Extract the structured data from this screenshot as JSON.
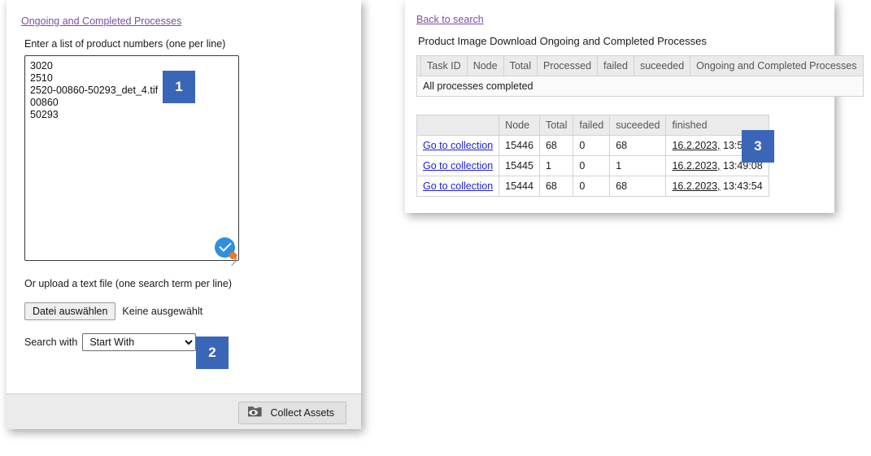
{
  "left_panel": {
    "top_link": "Ongoing and Completed Processes",
    "textarea_label": "Enter a list of product numbers (one per line)",
    "textarea_value": "3020\n2510\n2520-00860-50293_det_4.tif\n00860\n50293",
    "textarea_placeholder": "",
    "upload_label": "Or upload a text file (one search term per line)",
    "file_button_label": "Datei auswählen",
    "file_status_text": "Keine ausgewählt",
    "search_with_label": "Search with",
    "search_with_value": "Start With",
    "search_with_options": [
      "Start With"
    ],
    "footer": {
      "collect_button_label": "Collect Assets",
      "collect_button_icon": "folder-eye-icon"
    }
  },
  "right_panel": {
    "back_link": "Back to search",
    "heading": "Product Image Download Ongoing and Completed Processes",
    "processes_table": {
      "columns": [
        "",
        "Task ID",
        "Node",
        "Total",
        "Processed",
        "failed",
        "suceeded",
        "Ongoing and Completed Processes"
      ],
      "empty_message": "All processes completed"
    },
    "completed_table": {
      "columns": [
        "",
        "Node",
        "Total",
        "failed",
        "suceeded",
        "finished"
      ],
      "rows": [
        {
          "link": "Go to collection",
          "node": "15446",
          "total": "68",
          "failed": "0",
          "suceeded": "68",
          "finished_date": "16.2.2023,",
          "finished_time": "13:54:18"
        },
        {
          "link": "Go to collection",
          "node": "15445",
          "total": "1",
          "failed": "0",
          "suceeded": "1",
          "finished_date": "16.2.2023,",
          "finished_time": "13:49:08"
        },
        {
          "link": "Go to collection",
          "node": "15444",
          "total": "68",
          "failed": "0",
          "suceeded": "68",
          "finished_date": "16.2.2023,",
          "finished_time": "13:43:54"
        }
      ]
    }
  },
  "callouts": [
    {
      "number": "1"
    },
    {
      "number": "2"
    },
    {
      "number": "3"
    }
  ],
  "colors": {
    "callout_blue": "#3a66b8",
    "visited_link_purple": "#7b4ea0",
    "link_blue": "#2020dd",
    "check_badge_blue": "#2e8fe0",
    "check_badge_dot_orange": "#f07a20"
  }
}
